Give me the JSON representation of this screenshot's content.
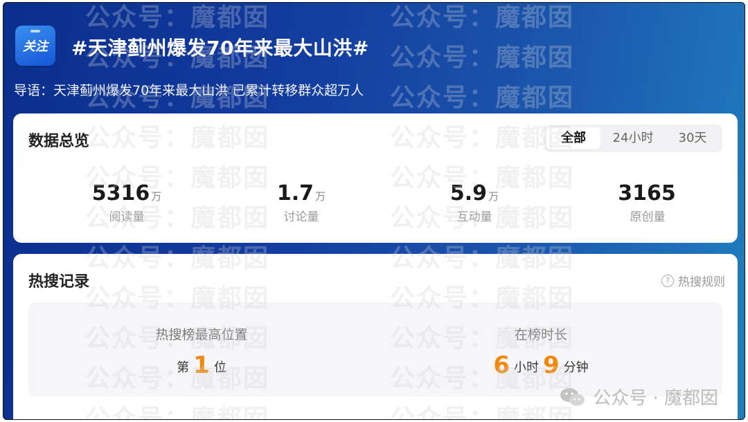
{
  "header": {
    "follow_label": "关注",
    "topic_title": "#天津蓟州爆发70年来最大山洪#",
    "intro": "导语：天津蓟州爆发70年来最大山洪 已累计转移群众超万人"
  },
  "overview": {
    "title": "数据总览",
    "tabs": [
      {
        "label": "全部",
        "active": true
      },
      {
        "label": "24小时",
        "active": false
      },
      {
        "label": "30天",
        "active": false
      }
    ],
    "stats": [
      {
        "value": "5316",
        "unit": "万",
        "label": "阅读量"
      },
      {
        "value": "1.7",
        "unit": "万",
        "label": "讨论量"
      },
      {
        "value": "5.9",
        "unit": "万",
        "label": "互动量"
      },
      {
        "value": "3165",
        "unit": "",
        "label": "原创量"
      }
    ]
  },
  "hot_search": {
    "title": "热搜记录",
    "rules_label": "热搜规则",
    "best_position": {
      "label": "热搜榜最高位置",
      "prefix": "第",
      "value": "1",
      "suffix": "位"
    },
    "duration": {
      "label": "在榜时长",
      "hours": "6",
      "hours_unit": "小时",
      "minutes": "9",
      "minutes_unit": "分钟"
    }
  },
  "watermark": {
    "text_public": "公众号：",
    "text_brand": "魔都囡",
    "wechat_label": "公众号 · 魔都囡"
  },
  "colors": {
    "header_gradient_start": "#0a2f8d",
    "header_gradient_end": "#1f7fbf",
    "highlight_orange": "#f2890b"
  }
}
